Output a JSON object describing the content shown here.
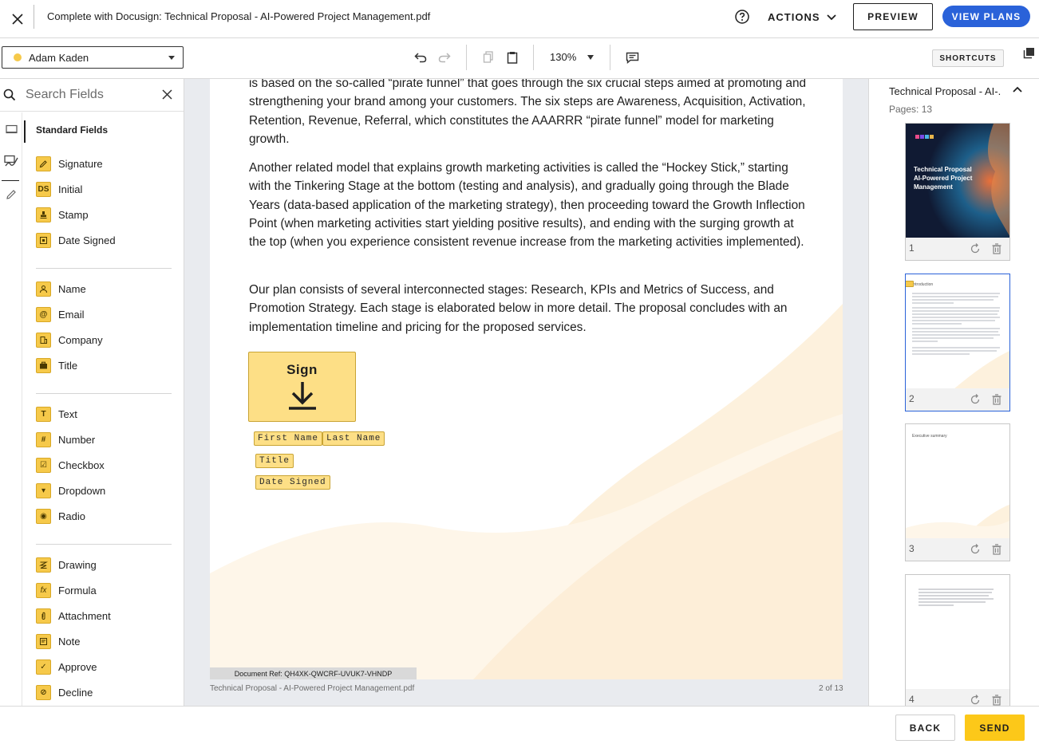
{
  "header": {
    "title": "Complete with Docusign: Technical Proposal - AI-Powered Project Management.pdf",
    "actions_label": "ACTIONS",
    "preview_label": "PREVIEW",
    "view_plans_label": "VIEW PLANS"
  },
  "toolbar": {
    "recipient_name": "Adam Kaden",
    "recipient_color": "#f6c94a",
    "zoom": "130%",
    "shortcuts_label": "SHORTCUTS"
  },
  "left_panel": {
    "search_placeholder": "Search Fields",
    "section_title": "Standard Fields",
    "fields": [
      {
        "label": "Signature",
        "icon": "signature-icon"
      },
      {
        "label": "Initial",
        "icon": "initial-icon",
        "glyph": "DS"
      },
      {
        "label": "Stamp",
        "icon": "stamp-icon"
      },
      {
        "label": "Date Signed",
        "icon": "date-signed-icon"
      },
      {
        "label": "Name",
        "icon": "person-icon"
      },
      {
        "label": "Email",
        "icon": "at-icon",
        "glyph": "@"
      },
      {
        "label": "Company",
        "icon": "building-icon"
      },
      {
        "label": "Title",
        "icon": "briefcase-icon"
      },
      {
        "label": "Text",
        "icon": "text-icon",
        "glyph": "T"
      },
      {
        "label": "Number",
        "icon": "hash-icon",
        "glyph": "#"
      },
      {
        "label": "Checkbox",
        "icon": "checkbox-icon",
        "glyph": "☑"
      },
      {
        "label": "Dropdown",
        "icon": "dropdown-icon",
        "glyph": "▾"
      },
      {
        "label": "Radio",
        "icon": "radio-icon",
        "glyph": "◉"
      },
      {
        "label": "Drawing",
        "icon": "drawing-icon"
      },
      {
        "label": "Formula",
        "icon": "formula-icon",
        "glyph": "fx"
      },
      {
        "label": "Attachment",
        "icon": "paperclip-icon"
      },
      {
        "label": "Note",
        "icon": "note-icon"
      },
      {
        "label": "Approve",
        "icon": "check-icon",
        "glyph": "✓"
      },
      {
        "label": "Decline",
        "icon": "decline-icon",
        "glyph": "⊘"
      }
    ]
  },
  "document": {
    "paragraphs": [
      "is based on the so-called “pirate funnel” that goes through the six crucial steps aimed at promoting and strengthening your brand among your customers. The six steps are Awareness, Acquisition, Activation, Retention, Revenue, Referral, which constitutes the AAARRR “pirate funnel” model for marketing growth.",
      "Another related model that explains growth marketing activities is called the “Hockey Stick,” starting with the Tinkering Stage at the bottom (testing and analysis), and gradually going through the Blade Years (data-based application of the marketing strategy), then proceeding toward the Growth Inflection Point (when marketing activities start yielding positive results), and ending with the surging growth at the top (when you experience consistent revenue increase from the marketing activities implemented).",
      "Our plan consists of several interconnected stages: Research, KPIs and Metrics of Success, and Promotion Strategy. Each stage is elaborated below in more detail. The proposal concludes with an implementation timeline and pricing for the proposed services."
    ],
    "sign_label": "Sign",
    "tags": {
      "first_name": "First Name",
      "last_name": "Last Name",
      "title": "Title",
      "date_signed": "Date Signed"
    },
    "doc_ref": "Document Ref: QH4XK-QWCRF-UVUK7-VHNDP",
    "footer_filename": "Technical Proposal - AI-Powered Project Management.pdf",
    "footer_page": "2 of 13"
  },
  "right_panel": {
    "title": "Technical Proposal - AI-...",
    "pages_label": "Pages: 13",
    "thumbnails": [
      {
        "number": "1",
        "cover_title": "Technical Proposal AI-Powered Project Management"
      },
      {
        "number": "2",
        "heading": "Introduction"
      },
      {
        "number": "3",
        "heading": "Executive summary"
      },
      {
        "number": "4"
      }
    ]
  },
  "footer": {
    "back_label": "BACK",
    "send_label": "SEND"
  }
}
